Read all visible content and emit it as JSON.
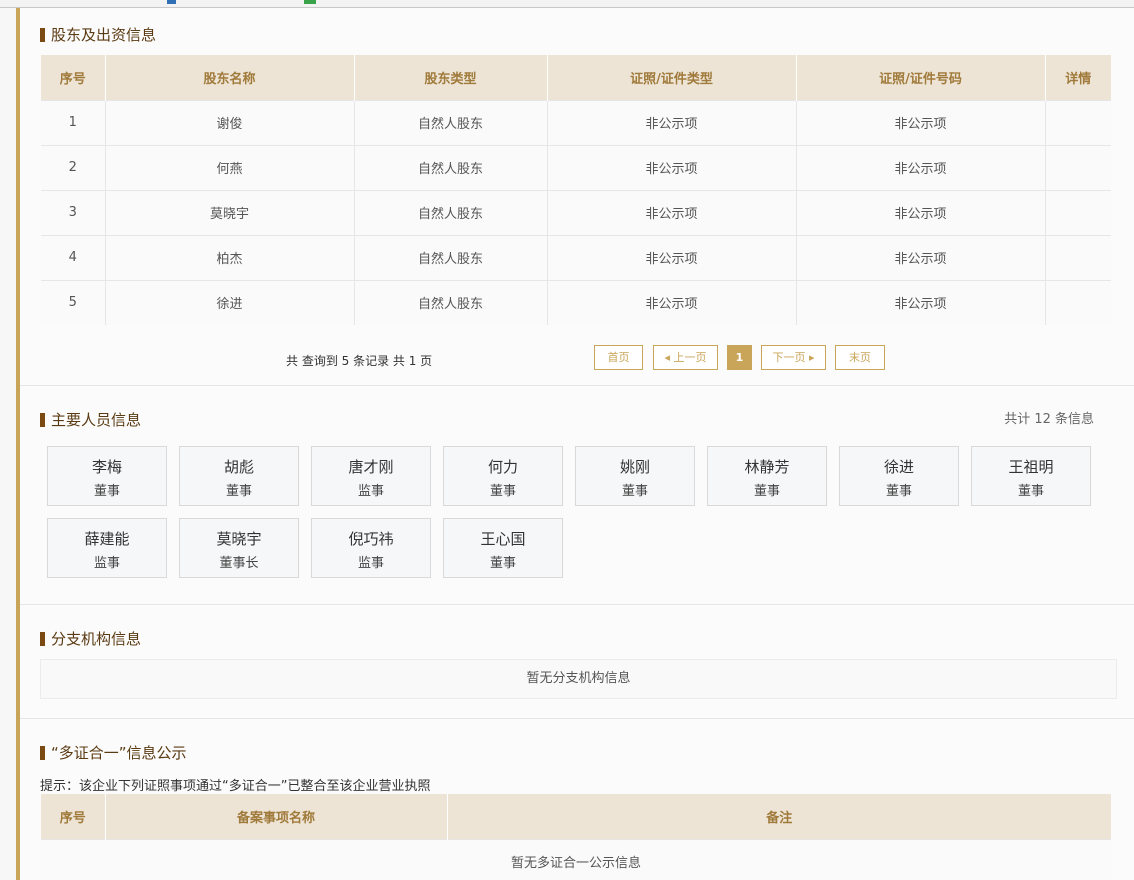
{
  "shareholders": {
    "title": "股东及出资信息",
    "columns": [
      "序号",
      "股东名称",
      "股东类型",
      "证照/证件类型",
      "证照/证件号码",
      "详情"
    ],
    "rows": [
      [
        "1",
        "谢俊",
        "自然人股东",
        "非公示项",
        "非公示项",
        ""
      ],
      [
        "2",
        "何燕",
        "自然人股东",
        "非公示项",
        "非公示项",
        ""
      ],
      [
        "3",
        "莫晓宇",
        "自然人股东",
        "非公示项",
        "非公示项",
        ""
      ],
      [
        "4",
        "柏杰",
        "自然人股东",
        "非公示项",
        "非公示项",
        ""
      ],
      [
        "5",
        "徐进",
        "自然人股东",
        "非公示项",
        "非公示项",
        ""
      ]
    ],
    "pager": {
      "info": "共 查询到 5 条记录 共 1 页",
      "first": "首页",
      "prev": "◂ 上一页",
      "current": "1",
      "next": "下一页 ▸",
      "last": "末页"
    }
  },
  "personnel": {
    "title": "主要人员信息",
    "count": "共计 12 条信息",
    "people": [
      {
        "name": "李梅",
        "role": "董事"
      },
      {
        "name": "胡彪",
        "role": "董事"
      },
      {
        "name": "唐才刚",
        "role": "监事"
      },
      {
        "name": "何力",
        "role": "董事"
      },
      {
        "name": "姚刚",
        "role": "董事"
      },
      {
        "name": "林静芳",
        "role": "董事"
      },
      {
        "name": "徐进",
        "role": "董事"
      },
      {
        "name": "王祖明",
        "role": "董事"
      },
      {
        "name": "薛建能",
        "role": "监事"
      },
      {
        "name": "莫晓宇",
        "role": "董事长"
      },
      {
        "name": "倪巧祎",
        "role": "监事"
      },
      {
        "name": "王心国",
        "role": "董事"
      }
    ]
  },
  "branches": {
    "title": "分支机构信息",
    "empty": "暂无分支机构信息"
  },
  "multicert": {
    "title": "“多证合一”信息公示",
    "hint": "提示：该企业下列证照事项通过“多证合一”已整合至该企业营业执照",
    "columns": [
      "序号",
      "备案事项名称",
      "备注"
    ],
    "empty": "暂无多证合一公示信息"
  },
  "colors": {
    "accent": "#c9a55a",
    "header_bg": "#ede4d6",
    "header_text": "#a07a3a",
    "title_bar": "#7a4a12"
  }
}
